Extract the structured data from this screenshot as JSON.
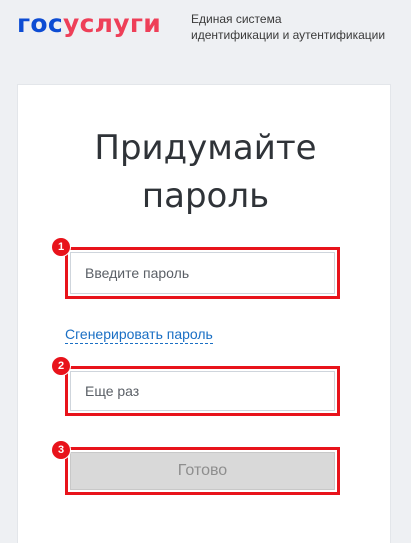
{
  "header": {
    "logo_part1": "гос",
    "logo_part2": "услуги",
    "tagline_line1": "Единая система",
    "tagline_line2": "идентификации и аутентификации"
  },
  "form": {
    "title_line1": "Придумайте",
    "title_line2": "пароль",
    "password_placeholder": "Введите пароль",
    "generate_link": "Сгенерировать пароль",
    "repeat_placeholder": "Еще раз",
    "submit_label": "Готово"
  },
  "annotations": [
    "1",
    "2",
    "3"
  ],
  "colors": {
    "brand_blue": "#0d4cd3",
    "brand_red": "#ee3f58",
    "highlight_red": "#e8131b",
    "link_blue": "#1a6fc4",
    "disabled_button": "#d9d9d9"
  }
}
